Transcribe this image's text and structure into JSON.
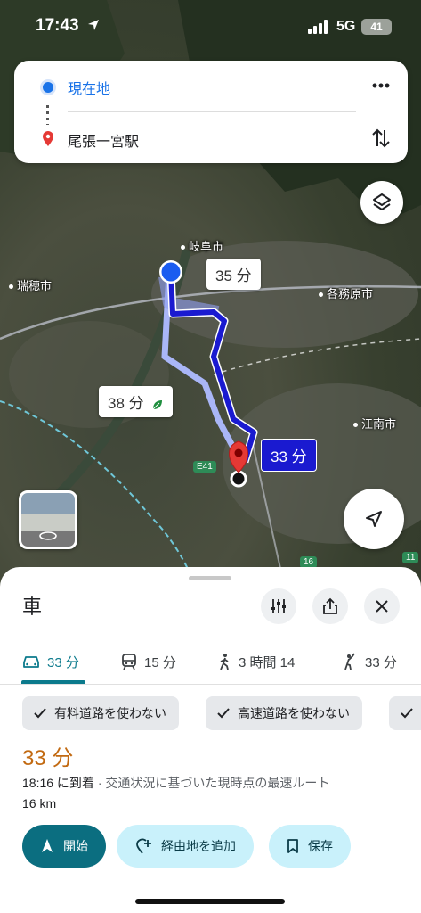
{
  "status_bar": {
    "time": "17:43",
    "network": "5G",
    "battery": "41"
  },
  "route_card": {
    "origin": "現在地",
    "destination": "尾張一宮駅"
  },
  "map": {
    "labels": {
      "gifu": "岐阜市",
      "mizuho": "瑞穂市",
      "kakamigahara": "各務原市",
      "konan": "江南市"
    },
    "road_shields": {
      "e41": "E41",
      "r16": "16",
      "r11": "11"
    },
    "bubbles": {
      "alt1": "35 分",
      "alt2": "38 分",
      "main": "33 分"
    }
  },
  "sheet": {
    "title": "車",
    "modes": [
      {
        "label": "33 分",
        "icon": "car-icon"
      },
      {
        "label": "15 分",
        "icon": "train-icon"
      },
      {
        "label": "3 時間 14",
        "icon": "walk-icon"
      },
      {
        "label": "33 分",
        "icon": "hail-icon"
      }
    ],
    "chips": [
      "有料道路を使わない",
      "高速道路を使わない"
    ],
    "duration": "33 分",
    "arrival_time": "18:16 に到着",
    "arrival_note": " · 交通状況に基づいた現時点の最速ルート",
    "distance": "16 km",
    "actions": {
      "start": "開始",
      "add_stop": "経由地を追加",
      "save": "保存"
    }
  },
  "colors": {
    "accent": "#0b6e80",
    "duration": "#c26a12",
    "route": "#1a1ad0",
    "destination_pin": "#e53935"
  }
}
